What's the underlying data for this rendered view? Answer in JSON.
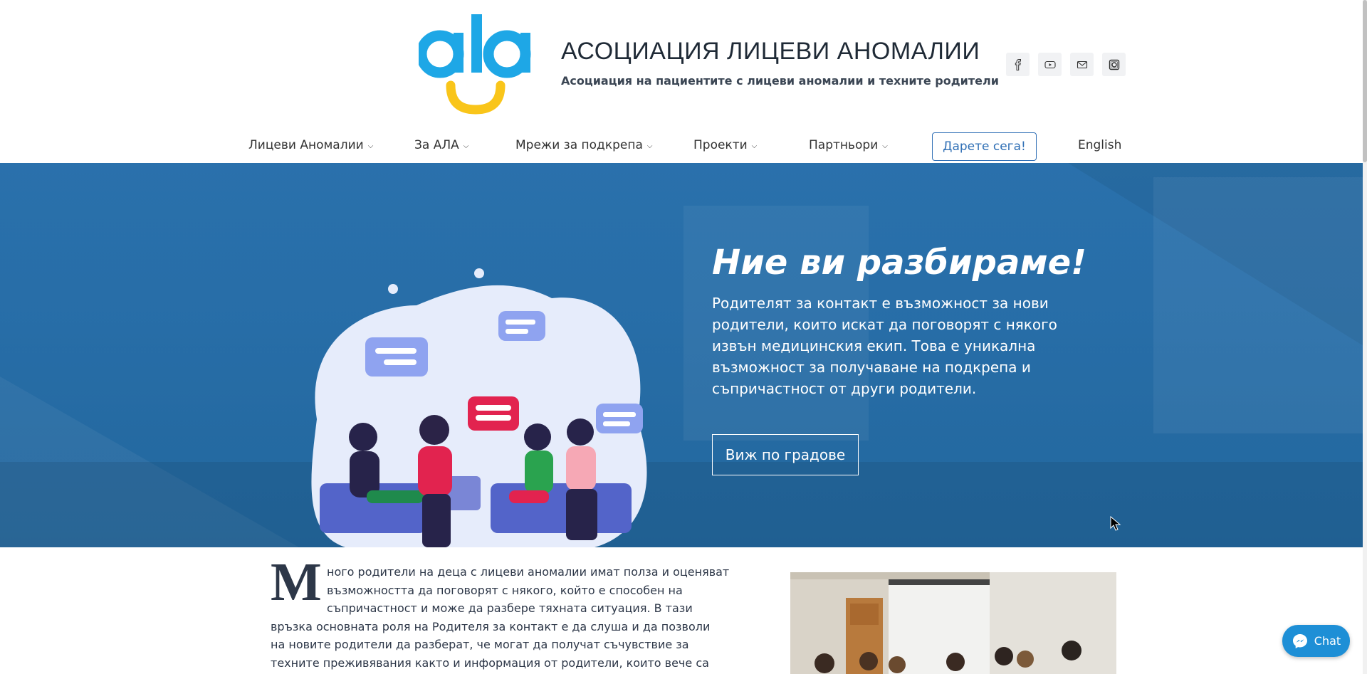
{
  "header": {
    "title": "АСОЦИАЦИЯ ЛИЦЕВИ АНОМАЛИИ",
    "subtitle": "Асоциация на пациентите с лицеви аномалии и техните родители",
    "logo_text": "ala",
    "socials": [
      "facebook-icon",
      "youtube-icon",
      "mail-icon",
      "instagram-icon"
    ]
  },
  "nav": {
    "items": [
      {
        "label": "Лицеви Аномалии"
      },
      {
        "label": "За АЛА"
      },
      {
        "label": "Мрежи за подкрепа"
      },
      {
        "label": "Проекти"
      },
      {
        "label": "Партньори"
      }
    ],
    "donate": "Дарете сега!",
    "language": "English"
  },
  "hero": {
    "title": "Ние ви разбираме!",
    "text": "Родителят за контакт е възможност за нови родители, които искат да поговорят с някого извън медицинския екип. Това е уникална възможност за получаване на подкрепа и съпричастност от други родители.",
    "button": "Виж по градове"
  },
  "article": {
    "drop_cap": "М",
    "lines": [
      "ного родители на деца с лицеви аномалии имат полза и оценяват",
      "възможността да поговорят с някого, който е способен на",
      "съпричастност и може да разбере тяхната ситуация. В тази",
      "връзка основната роля на Родителя за контакт е да слуша и да позволи",
      "на новите родители да разберат, че могат да получат съчувствие за",
      "техните преживявания както и информация от родители, които вече са"
    ]
  },
  "chat": {
    "label": "Chat"
  },
  "colors": {
    "accent": "#2f6fb5",
    "hero_overlay": "#1f6eb4",
    "logo_blue": "#1ea7e6",
    "logo_yellow": "#f9c51a",
    "chat": "#1e8fd6"
  }
}
